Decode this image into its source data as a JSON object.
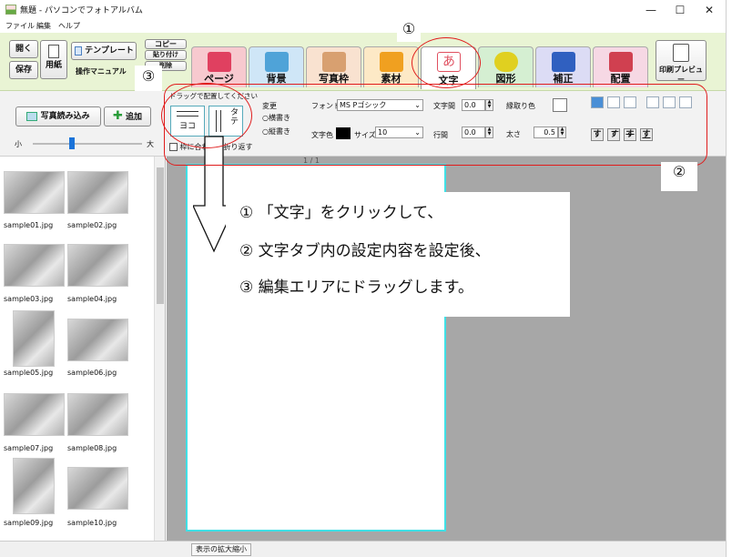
{
  "window": {
    "title": "無題 - パソコンでフォトアルバム",
    "minimize_glyph": "—",
    "maximize_glyph": "☐",
    "close_glyph": "✕"
  },
  "menu": [
    "ファイル",
    "編集",
    "ヘルプ"
  ],
  "toolbar": {
    "open_label": "開く",
    "save_label": "保存",
    "paper_label": "用紙",
    "template_label": "テンプレート",
    "manual_label": "操作マニュアル",
    "copy_label": "コピー",
    "paste_label": "貼り付け",
    "delete_label": "削除",
    "print_preview_label": "印刷プレビュー",
    "tabs": [
      {
        "label": "ページ",
        "color": "#f7c9cf",
        "art": "#e04060"
      },
      {
        "label": "背景",
        "color": "#cfe6f7",
        "art": "#4fa3d8"
      },
      {
        "label": "写真枠",
        "color": "#f9e2d0",
        "art": "#d8a070"
      },
      {
        "label": "素材",
        "color": "#fde9c6",
        "art": "#f0a020"
      },
      {
        "label": "文字",
        "color": "#ffffff",
        "art": "#e05060"
      },
      {
        "label": "図形",
        "color": "#d5efd2",
        "art": "#e0d020"
      },
      {
        "label": "補正",
        "color": "#dcdcf5",
        "art": "#3060c0"
      },
      {
        "label": "配置",
        "color": "#f6d8e4",
        "art": "#d04050"
      }
    ]
  },
  "left_controls": {
    "load_photos_label": "写真読み込み",
    "add_label": "追加",
    "size_small": "小",
    "size_large": "大",
    "zoom_fraction": 0.36
  },
  "text_panel": {
    "drag_hint": "ドラッグで配置してください",
    "yoko_label": "ヨコ",
    "tate_label": "タテ",
    "change_label": "変更",
    "horizontal_label": "横書き",
    "vertical_label": "縦書き",
    "wrap_label": "枠に合わせて折り返す",
    "font_label": "フォント",
    "font_value": "MS Pゴシック",
    "color_label": "文字色",
    "size_label": "サイズ",
    "size_value": "10",
    "char_spacing_label": "文字間",
    "char_spacing_value": "0.0",
    "line_spacing_label": "行間",
    "line_spacing_value": "0.0",
    "outline_color_label": "縁取り色",
    "thickness_label": "太さ",
    "thickness_value": "0.5",
    "style_buttons": [
      "す",
      "す",
      "す",
      "す"
    ]
  },
  "page_indicator": "1 / 1",
  "thumbnails": [
    "sample01.jpg",
    "sample02.jpg",
    "sample03.jpg",
    "sample04.jpg",
    "sample05.jpg",
    "sample06.jpg",
    "sample07.jpg",
    "sample08.jpg",
    "sample09.jpg",
    "sample10.jpg"
  ],
  "callout": {
    "line1": "① 「文字」をクリックして、",
    "line2": "② 文字タブ内の設定内容を設定後、",
    "line3": "③ 編集エリアにドラッグします。"
  },
  "markers": {
    "m1": "①",
    "m2": "②",
    "m3": "③"
  },
  "statusbar": {
    "zoom_button": "表示の拡大縮小"
  },
  "colors": {
    "toolbar_bg": "#e9f4d4",
    "annotation_red": "#e01c1c",
    "page_border": "#3fe0e6",
    "edit_area_bg": "#a7a7a7"
  }
}
